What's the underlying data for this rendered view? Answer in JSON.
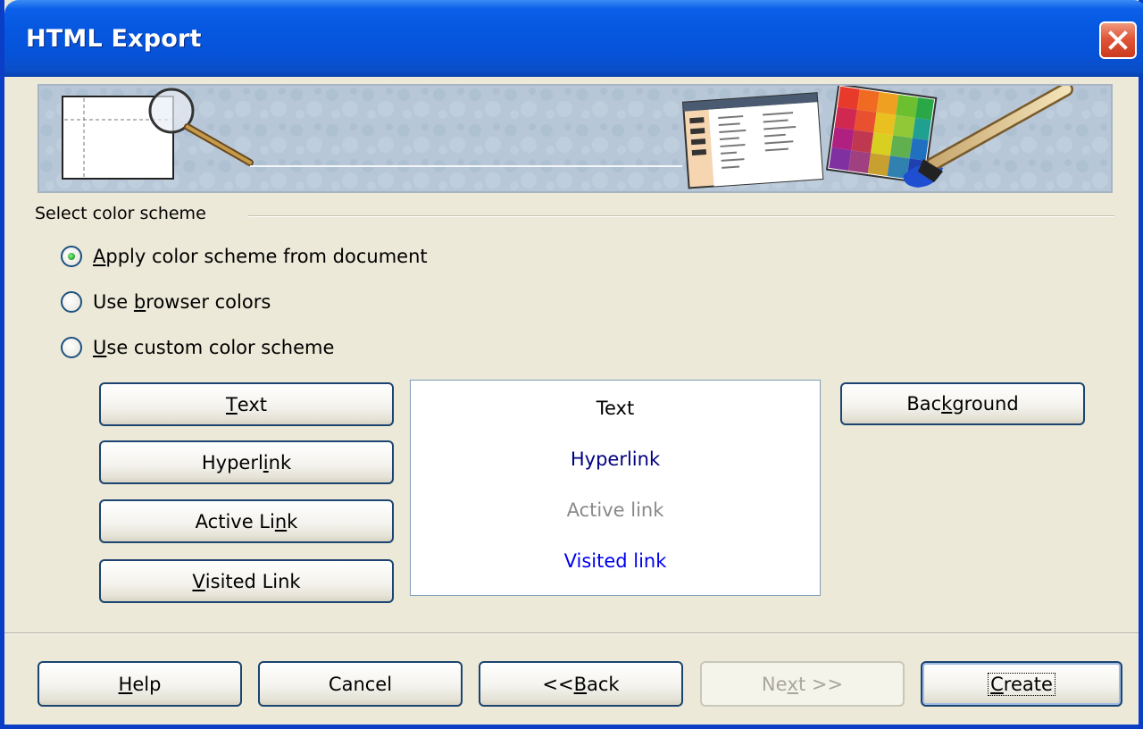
{
  "window": {
    "title": "HTML Export"
  },
  "group": {
    "label": "Select color scheme"
  },
  "radios": [
    {
      "pre": "",
      "accel": "A",
      "post": "pply color scheme from document",
      "checked": true
    },
    {
      "pre": "Use ",
      "accel": "b",
      "post": "rowser colors",
      "checked": false
    },
    {
      "pre": "",
      "accel": "U",
      "post": "se custom color scheme",
      "checked": false
    }
  ],
  "color_buttons": {
    "text": {
      "pre": "",
      "accel": "T",
      "post": "ext"
    },
    "hyperlink": {
      "pre": "Hyperl",
      "accel": "i",
      "post": "nk"
    },
    "active_link": {
      "pre": "Active Li",
      "accel": "n",
      "post": "k"
    },
    "visited_link": {
      "pre": "",
      "accel": "V",
      "post": "isited Link"
    },
    "background": {
      "pre": "Bac",
      "accel": "k",
      "post": "ground"
    }
  },
  "preview": {
    "text": "Text",
    "hyperlink": "Hyperlink",
    "active_link": "Active link",
    "visited_link": "Visited link",
    "colors": {
      "text": "#000000",
      "hyperlink": "#000080",
      "active_link": "#8a8a8a",
      "visited_link": "#0000ee"
    }
  },
  "footer": {
    "help": {
      "pre": "",
      "accel": "H",
      "post": "elp"
    },
    "cancel": {
      "pre": "Cancel",
      "accel": "",
      "post": ""
    },
    "back": {
      "pre": "<< ",
      "accel": "B",
      "post": "ack"
    },
    "next": {
      "pre": "Ne",
      "accel": "x",
      "post": "t >>",
      "disabled": true
    },
    "create": {
      "pre": "",
      "accel": "C",
      "post": "reate",
      "default": true
    }
  },
  "icons": {
    "close": "close-icon",
    "banner": "html-export-banner-image"
  }
}
